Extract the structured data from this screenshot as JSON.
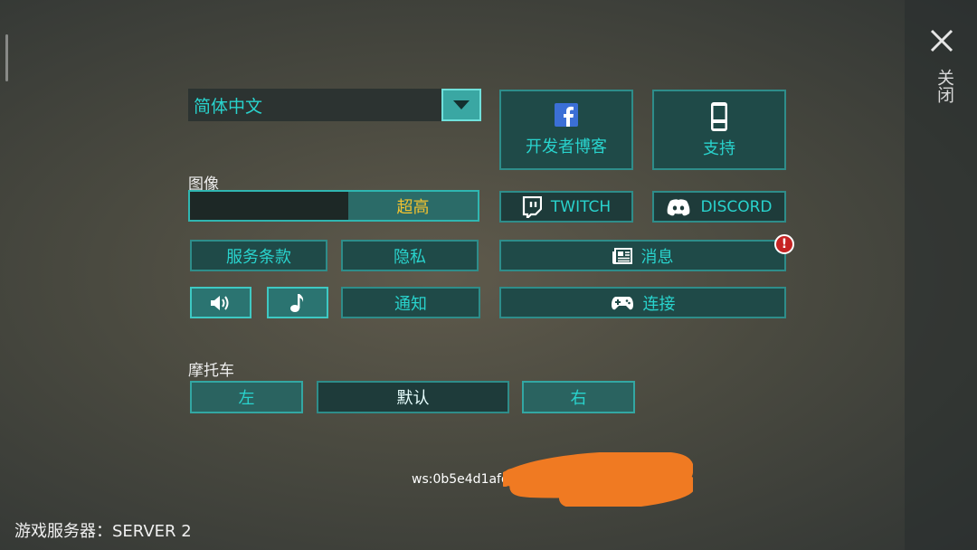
{
  "language": {
    "selected": "简体中文"
  },
  "graphics": {
    "label": "图像",
    "quality_value": "超高",
    "quality_level": 0.45
  },
  "social": {
    "developer_blog": "开发者博客",
    "support": "支持",
    "twitch": "TWITCH",
    "discord": "DISCORD",
    "news": "消息",
    "connect": "连接"
  },
  "links": {
    "terms": "服务条款",
    "privacy": "隐私",
    "notifications": "通知"
  },
  "motorcycle": {
    "label": "摩托车",
    "left": "左",
    "default": "默认",
    "right": "右"
  },
  "close": {
    "label": "关闭"
  },
  "footer": {
    "ws": "ws:0b5e4d1afd",
    "server": "游戏服务器：SERVER 2"
  },
  "icons": {
    "dropdown": "chevron-down-icon",
    "facebook": "facebook-icon",
    "support": "phone-icon",
    "twitch": "twitch-icon",
    "discord": "discord-icon",
    "news": "newspaper-icon",
    "connect": "gamepad-icon",
    "sound": "speaker-icon",
    "music": "music-note-icon",
    "alert": "alert-icon",
    "close": "close-icon"
  },
  "colors": {
    "accent": "#29d3cd",
    "button_bg": "#1f4a48",
    "button_border": "#2e8d8a",
    "quality_text": "#f2c230",
    "alert": "#c62323",
    "redaction": "#f07a22"
  }
}
